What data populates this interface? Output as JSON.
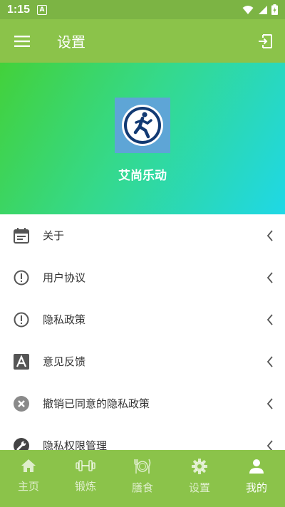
{
  "status_bar": {
    "time": "1:15",
    "notification_icon": "A"
  },
  "header": {
    "title": "设置"
  },
  "profile": {
    "app_name": "艾尚乐动"
  },
  "menu_items": [
    {
      "label": "关于",
      "icon": "calendar-icon"
    },
    {
      "label": "用户协议",
      "icon": "alert-circle-icon"
    },
    {
      "label": "隐私政策",
      "icon": "alert-circle-icon"
    },
    {
      "label": "意见反馈",
      "icon": "letter-a-icon"
    },
    {
      "label": "撤销已同意的隐私政策",
      "icon": "cancel-circle-icon"
    },
    {
      "label": "隐私权限管理",
      "icon": "wrench-icon"
    }
  ],
  "tabs": [
    {
      "label": "主页",
      "icon": "home-icon"
    },
    {
      "label": "锻炼",
      "icon": "dumbbell-icon"
    },
    {
      "label": "膳食",
      "icon": "meal-icon"
    },
    {
      "label": "设置",
      "icon": "gear-icon"
    },
    {
      "label": "我的",
      "icon": "person-icon",
      "active": true
    }
  ],
  "colors": {
    "primary": "#8bc34a",
    "status_bar": "#7cb444",
    "gradient_start": "#43d13a",
    "gradient_end": "#1fd8e6"
  }
}
